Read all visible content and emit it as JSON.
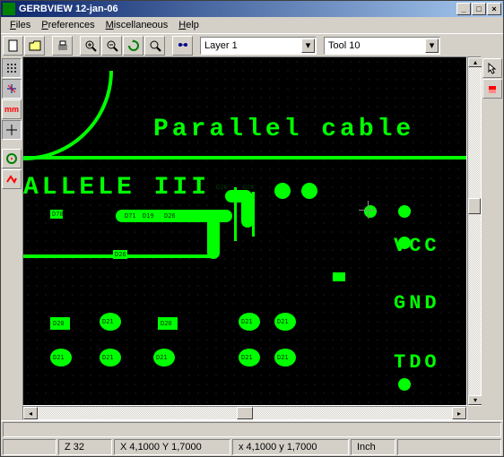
{
  "title": "GERBVIEW 12-jan-06",
  "menu": {
    "files": "Files",
    "preferences": "Preferences",
    "miscellaneous": "Miscellaneous",
    "help": "Help"
  },
  "layer_select": "Layer 1",
  "tool_select": "Tool 10",
  "pcb_text": {
    "header": "Parallel cable",
    "allele": "ALLELE III",
    "vcc": "VCC",
    "gnd": "GND",
    "tdo": "TDO"
  },
  "labels": {
    "d26": "D26",
    "d70": "D70",
    "d71": "D71",
    "d19": "D19",
    "d20": "D20",
    "d21": "D21"
  },
  "status": {
    "z": "Z 32",
    "xy_abs": "X 4,1000  Y 1,7000",
    "xy_rel": "x 4,1000  y 1,7000",
    "unit": "Inch"
  }
}
